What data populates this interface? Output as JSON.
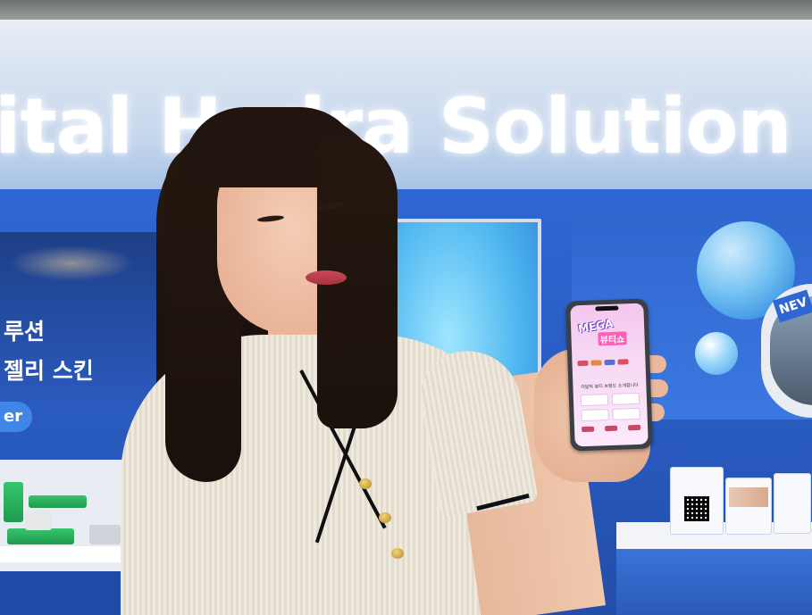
{
  "scene": {
    "sign_text": "ital Hydra Solution",
    "left_panel_line1": "루션",
    "left_panel_line2": "젤리 스킨",
    "left_panel_pill": "er",
    "window_badge": "NEV"
  },
  "phone": {
    "title": "MEGA",
    "subtitle": "뷰티쇼",
    "caption": "이달의 뷰티 브랜드 소개합니다"
  },
  "colors": {
    "booth_blue": "#2e67d4",
    "sign_white": "#ffffff",
    "phone_screen_pink": "#f3c7ee"
  }
}
